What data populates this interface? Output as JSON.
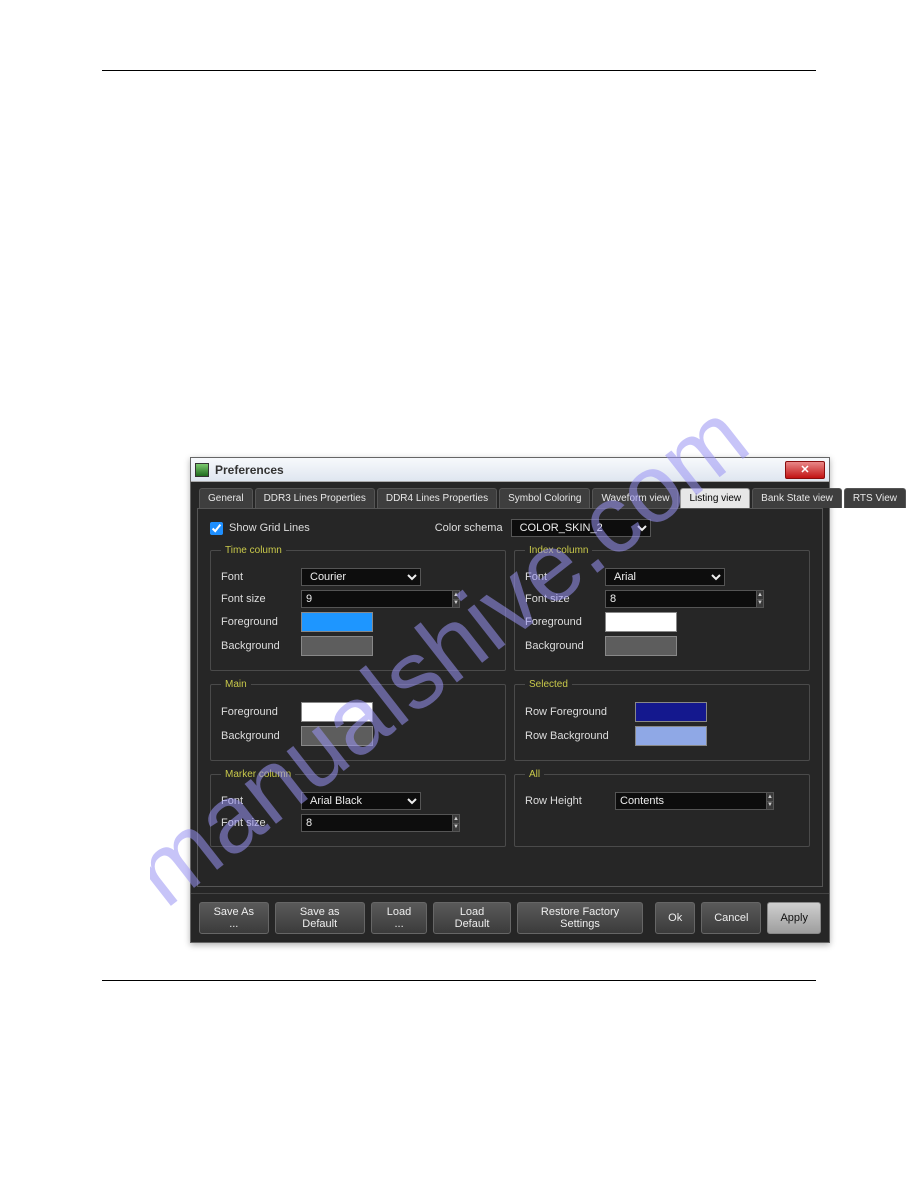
{
  "window": {
    "title": "Preferences"
  },
  "tabs": [
    {
      "label": "General"
    },
    {
      "label": "DDR3 Lines Properties"
    },
    {
      "label": "DDR4 Lines Properties"
    },
    {
      "label": "Symbol Coloring"
    },
    {
      "label": "Waveform view"
    },
    {
      "label": "Listing view"
    },
    {
      "label": "Bank State view"
    },
    {
      "label": "RTS View"
    }
  ],
  "listing": {
    "show_grid_lines_label": "Show Grid Lines",
    "show_grid_lines": true,
    "color_schema_label": "Color schema",
    "color_schema_value": "COLOR_SKIN_2"
  },
  "groups": {
    "time_column": {
      "legend": "Time column",
      "font_label": "Font",
      "font_value": "Courier",
      "font_size_label": "Font size",
      "font_size_value": "9",
      "foreground_label": "Foreground",
      "foreground_color": "#1e96ff",
      "background_label": "Background",
      "background_color": "#5d5d5d"
    },
    "index_column": {
      "legend": "Index column",
      "font_label": "Font",
      "font_value": "Arial",
      "font_size_label": "Font size",
      "font_size_value": "8",
      "foreground_label": "Foreground",
      "foreground_color": "#ffffff",
      "background_label": "Background",
      "background_color": "#5d5d5d"
    },
    "main": {
      "legend": "Main",
      "foreground_label": "Foreground",
      "foreground_color": "#ffffff",
      "background_label": "Background",
      "background_color": "#5d5d5d"
    },
    "selected": {
      "legend": "Selected",
      "row_fg_label": "Row Foreground",
      "row_fg_color": "#14188e",
      "row_bg_label": "Row Background",
      "row_bg_color": "#8fa8e6"
    },
    "marker_column": {
      "legend": "Marker column",
      "font_label": "Font",
      "font_value": "Arial Black",
      "font_size_label": "Font size",
      "font_size_value": "8"
    },
    "all": {
      "legend": "All",
      "row_height_label": "Row Height",
      "row_height_value": "Contents"
    }
  },
  "buttons": {
    "save_as": "Save As ...",
    "save_default": "Save as Default",
    "load": "Load ...",
    "load_default": "Load Default",
    "restore": "Restore Factory Settings",
    "ok": "Ok",
    "cancel": "Cancel",
    "apply": "Apply"
  }
}
